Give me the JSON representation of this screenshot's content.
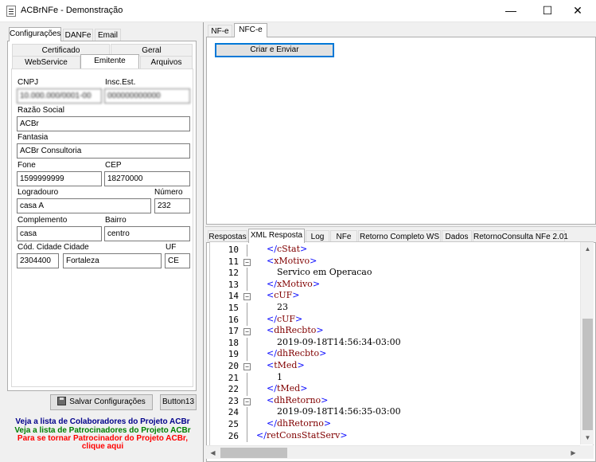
{
  "window": {
    "title": "ACBrNFe - Demonstração",
    "controls": {
      "minimize": "—",
      "maximize": "☐",
      "close": "✕"
    }
  },
  "left_tabs": [
    "Configurações",
    "DANFe",
    "Email"
  ],
  "config_tabs_row1": [
    "Certificado",
    "Geral"
  ],
  "config_tabs_row2": [
    "WebService",
    "Emitente",
    "Arquivos"
  ],
  "emitente": {
    "cnpj_label": "CNPJ",
    "cnpj_value": "10.000.000/0001-00",
    "ie_label": "Insc.Est.",
    "ie_value": "000000000000",
    "razao_label": "Razão Social",
    "razao_value": "ACBr",
    "fantasia_label": "Fantasia",
    "fantasia_value": "ACBr Consultoria",
    "fone_label": "Fone",
    "fone_value": "1599999999",
    "cep_label": "CEP",
    "cep_value": "18270000",
    "logradouro_label": "Logradouro",
    "logradouro_value": "casa A",
    "numero_label": "Número",
    "numero_value": "232",
    "complemento_label": "Complemento",
    "complemento_value": "casa",
    "bairro_label": "Bairro",
    "bairro_value": "centro",
    "cod_cidade_label": "Cód. Cidade",
    "cod_cidade_value": "2304400",
    "cidade_label": "Cidade",
    "cidade_value": "Fortaleza",
    "uf_label": "UF",
    "uf_value": "CE"
  },
  "buttons": {
    "salvar": "Salvar Configurações",
    "button13": "Button13",
    "criar_enviar": "Criar e Enviar"
  },
  "links": {
    "colaboradores": "Veja a lista de Colaboradores do Projeto ACBr",
    "patrocinadores": "Veja a lista de Patrocinadores do Projeto ACBr",
    "tornar_line1": "Para se tornar Patrocinador do Projeto ACBr,",
    "tornar_line2": "clique aqui"
  },
  "colors": {
    "link_blue": "#00008b",
    "link_green": "#008000",
    "link_red": "#ff0000",
    "xml_tag": "#800000",
    "xml_bracket": "#0000ff"
  },
  "top_tabs": [
    "NF-e",
    "NFC-e"
  ],
  "bottom_tabs": [
    "Respostas",
    "XML Resposta",
    "Log",
    "NFe",
    "Retorno Completo WS",
    "Dados",
    "RetornoConsulta NFe 2.01"
  ],
  "xml_lines": [
    {
      "n": "10",
      "indent": 1,
      "kind": "close",
      "name": "cStat",
      "text": ""
    },
    {
      "n": "11",
      "indent": 1,
      "kind": "open",
      "name": "xMotivo",
      "text": "",
      "fold": true
    },
    {
      "n": "12",
      "indent": 2,
      "kind": "text",
      "name": "",
      "text": "Servico em Operacao"
    },
    {
      "n": "13",
      "indent": 1,
      "kind": "close",
      "name": "xMotivo",
      "text": ""
    },
    {
      "n": "14",
      "indent": 1,
      "kind": "open",
      "name": "cUF",
      "text": "",
      "fold": true
    },
    {
      "n": "15",
      "indent": 2,
      "kind": "text",
      "name": "",
      "text": "23"
    },
    {
      "n": "16",
      "indent": 1,
      "kind": "close",
      "name": "cUF",
      "text": ""
    },
    {
      "n": "17",
      "indent": 1,
      "kind": "open",
      "name": "dhRecbto",
      "text": "",
      "fold": true
    },
    {
      "n": "18",
      "indent": 2,
      "kind": "text",
      "name": "",
      "text": "2019-09-18T14:56:34-03:00"
    },
    {
      "n": "19",
      "indent": 1,
      "kind": "close",
      "name": "dhRecbto",
      "text": ""
    },
    {
      "n": "20",
      "indent": 1,
      "kind": "open",
      "name": "tMed",
      "text": "",
      "fold": true
    },
    {
      "n": "21",
      "indent": 2,
      "kind": "text",
      "name": "",
      "text": "1"
    },
    {
      "n": "22",
      "indent": 1,
      "kind": "close",
      "name": "tMed",
      "text": ""
    },
    {
      "n": "23",
      "indent": 1,
      "kind": "open",
      "name": "dhRetorno",
      "text": "",
      "fold": true
    },
    {
      "n": "24",
      "indent": 2,
      "kind": "text",
      "name": "",
      "text": "2019-09-18T14:56:35-03:00"
    },
    {
      "n": "25",
      "indent": 1,
      "kind": "close",
      "name": "dhRetorno",
      "text": ""
    },
    {
      "n": "26",
      "indent": 0,
      "kind": "close",
      "name": "retConsStatServ",
      "text": ""
    }
  ]
}
